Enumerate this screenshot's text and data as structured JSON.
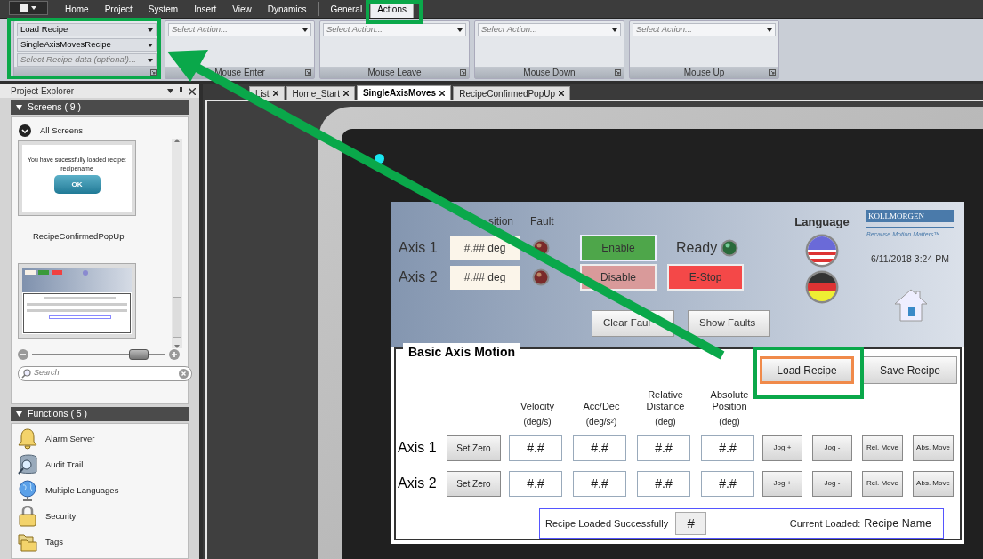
{
  "ribbon": {
    "menu_tabs": [
      {
        "label": "Home",
        "selected": false
      },
      {
        "label": "Project",
        "selected": false
      },
      {
        "label": "System",
        "selected": false
      },
      {
        "label": "Insert",
        "selected": false
      },
      {
        "label": "View",
        "selected": false
      },
      {
        "label": "Dynamics",
        "selected": false
      },
      {
        "label": "General",
        "selected": false
      },
      {
        "label": "Actions",
        "selected": true
      }
    ],
    "click_group": {
      "dropdowns": [
        {
          "value": "Load Recipe"
        },
        {
          "value": "SingleAxisMovesRecipe"
        },
        {
          "placeholder": "Select Recipe data (optional)..."
        }
      ]
    },
    "event_groups": [
      {
        "label": "Mouse Enter",
        "placeholder": "Select Action..."
      },
      {
        "label": "Mouse Leave",
        "placeholder": "Select Action..."
      },
      {
        "label": "Mouse Down",
        "placeholder": "Select Action..."
      },
      {
        "label": "Mouse Up",
        "placeholder": "Select Action..."
      }
    ]
  },
  "project_explorer": {
    "title": "Project Explorer",
    "screens": {
      "header": "Screens ( 9 )",
      "filter": "All Screens",
      "thumbnails": [
        {
          "kind": "popup",
          "message": "You have sucessfully loaded recipe:",
          "subtext": "recipename",
          "button": "OK",
          "name": "RecipeConfirmedPopUp"
        },
        {
          "kind": "screen"
        }
      ],
      "zoom": {
        "level": 0.8
      },
      "search_placeholder": "Search"
    },
    "functions": {
      "header": "Functions ( 5 )",
      "items": [
        {
          "kind": "bell",
          "label": "Alarm Server"
        },
        {
          "kind": "database",
          "label": "Audit Trail"
        },
        {
          "kind": "globe",
          "label": "Multiple Languages"
        },
        {
          "kind": "lock",
          "label": "Security"
        },
        {
          "kind": "folders",
          "label": "Tags"
        }
      ]
    }
  },
  "document_tabs": [
    {
      "label": "List",
      "selected": false
    },
    {
      "label": "Home_Start",
      "selected": false
    },
    {
      "label": "SingleAxisMoves",
      "selected": true
    },
    {
      "label": "RecipeConfirmedPopUp",
      "selected": false
    }
  ],
  "hmi": {
    "status": {
      "headers": [
        "sition",
        "Fault"
      ],
      "axes": [
        {
          "label": "Axis 1",
          "position": "#.## deg"
        },
        {
          "label": "Axis 2",
          "position": "#.## deg"
        }
      ],
      "buttons": [
        [
          {
            "kind": "enable",
            "label": "Enable"
          },
          {
            "kind": "ready",
            "label": "Ready"
          }
        ],
        [
          {
            "kind": "disable",
            "label": "Disable"
          },
          {
            "kind": "estop",
            "label": "E-Stop"
          }
        ]
      ],
      "fault_buttons": [
        "Clear Faul",
        "Show Faults"
      ],
      "language": {
        "title": "Language",
        "flags": [
          {
            "kind": "us"
          },
          {
            "kind": "de"
          }
        ]
      },
      "logo": {
        "name": "KOLLMORGEN",
        "tagline": "Because Motion Matters™"
      },
      "datetime": "6/11/2018 3:24 PM"
    },
    "motion": {
      "title": "Basic Axis Motion",
      "recipe_buttons": [
        {
          "label": "Load Recipe",
          "selected": true
        },
        {
          "label": "Save Recipe",
          "selected": false
        }
      ],
      "columns": [
        {
          "title": "Velocity",
          "unit": "(deg/s)"
        },
        {
          "title": "Acc/Dec",
          "unit": "(deg/s²)"
        },
        {
          "title": "Relative Distance",
          "unit": "(deg)"
        },
        {
          "title": "Absolute Position",
          "unit": "(deg)"
        }
      ],
      "rows": [
        {
          "label": "Axis 1",
          "zero": "Set Zero",
          "values": [
            "#.#",
            "#.#",
            "#.#",
            "#.#"
          ],
          "buttons": [
            "Jog +",
            "Jog -",
            "Rel. Move",
            "Abs. Move"
          ]
        },
        {
          "label": "Axis 2",
          "zero": "Set Zero",
          "values": [
            "#.#",
            "#.#",
            "#.#",
            "#.#"
          ],
          "buttons": [
            "Jog +",
            "Jog -",
            "Rel. Move",
            "Abs. Move"
          ]
        }
      ],
      "status": {
        "message": "Recipe Loaded Successfully",
        "indicator": "#",
        "current_label": "Current Loaded:",
        "current_value": "Recipe Name"
      }
    }
  }
}
